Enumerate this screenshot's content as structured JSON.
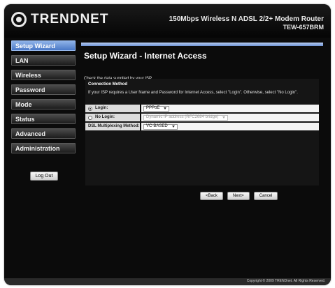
{
  "header": {
    "brand": "TRENDNET",
    "product_desc": "150Mbps Wireless N ADSL 2/2+ Modem Router",
    "model": "TEW-657BRM"
  },
  "nav": {
    "items": [
      {
        "label": "Setup Wizard"
      },
      {
        "label": "LAN"
      },
      {
        "label": "Wireless"
      },
      {
        "label": "Password"
      },
      {
        "label": "Mode"
      },
      {
        "label": "Status"
      },
      {
        "label": "Advanced"
      },
      {
        "label": "Administration"
      }
    ],
    "active": "Setup Wizard",
    "logout_label": "Log Out"
  },
  "page": {
    "title": "Setup Wizard - Internet Access",
    "instructions": "Check the data supplied by your ISP."
  },
  "connection": {
    "heading": "Connection Method",
    "description": "If your ISP requires a User Name and Password for Internet Access, select \"Login\". Otherwise, select \"No Login\".",
    "login_label": "Login:",
    "login_value": "PPPoE",
    "nologin_label": "No Login:",
    "nologin_value": "Dynamic IP address (RFC2684 bridge)",
    "dsl_label": "DSL Multiplexing Method:",
    "dsl_value": "VC-BASED",
    "selected": "Login"
  },
  "buttons": {
    "back": "<Back",
    "next": "Next>",
    "cancel": "Cancel"
  },
  "footer": {
    "copyright": "Copyright © 2009 TRENDnet. All Rights Reserved."
  },
  "colors": {
    "background": "#0b0b0b",
    "accent_active_nav": "#6e93d6",
    "title_bar": "#b8cdf0"
  }
}
